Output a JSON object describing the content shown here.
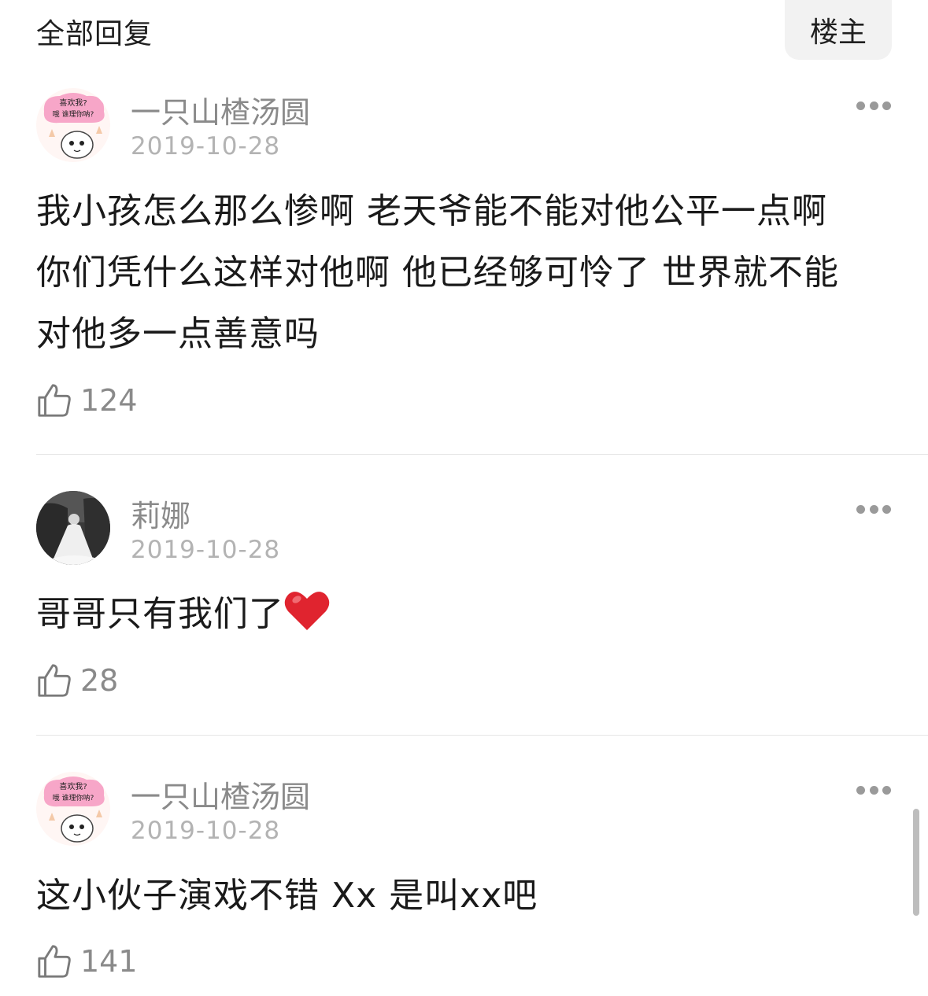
{
  "header": {
    "title": "全部回复",
    "owner_label": "楼主"
  },
  "comments": [
    {
      "author": "一只山楂汤圆",
      "date": "2019-10-28",
      "avatar_text_1": "喜欢我?",
      "avatar_text_2": "哦 谁理你呐?",
      "text_lines": [
        "我小孩怎么那么惨啊 老天爷能不能对他公平一点啊",
        "你们凭什么这样对他啊 他已经够可怜了 世界就不能",
        "对他多一点善意吗"
      ],
      "likes": "124"
    },
    {
      "author": "莉娜",
      "date": "2019-10-28",
      "text": "哥哥只有我们了",
      "emoji": "heart-emoji",
      "likes": "28"
    },
    {
      "author": "一只山楂汤圆",
      "date": "2019-10-28",
      "avatar_text_1": "喜欢我?",
      "avatar_text_2": "哦 谁理你呐?",
      "text": "这小伙子演戏不错 Xx 是叫xx吧",
      "likes": "141"
    }
  ],
  "colors": {
    "meta": "#8a8a8a",
    "date": "#b3b3b3",
    "heart": "#e0242f",
    "avatar_pink": "#f7a6c8"
  }
}
